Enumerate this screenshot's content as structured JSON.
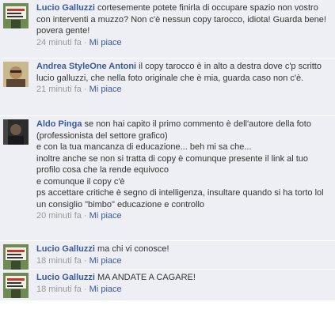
{
  "comments": [
    {
      "author": "Lucio Galluzzi",
      "text": "cortesemente potete finirla di occupare spazio non vostro con interventi a muzzo? Non c'è nessun copy tarocco, idiota! Guarda bene! povera gente!",
      "time": "24 minuti fa",
      "like": "Mi piace",
      "avatar": "avatar-photo-sign-icon"
    },
    {
      "author": "Andrea StyleOne Antoni",
      "text": "il copy tarocco è in alto a destra dove c'p scritto lucio galluzzi, che nella foto originale che è mia, guarda caso non c'è.",
      "time": "21 minuti fa",
      "like": "Mi piace",
      "avatar": "avatar-photo-face-icon"
    },
    {
      "author": "Aldo Pinga",
      "lines": [
        "se non hai capito il primo commento è dell'autore della foto (professionista del settore grafico)",
        "e con la tua mancanza di educazione... beh mi sa che...",
        "inoltre anche se non si tratta di copy è comunque presente il link al tuo profilo cosa che la rende equivoco",
        "e comunque il copy c'è",
        "ps accettare critiche è segno di intelligenza, insultare quando si ha torto lol",
        "un consiglio \"bimbo\" educazione e controllo"
      ],
      "time": "20 minuti fa",
      "like": "Mi piace",
      "avatar": "avatar-photo-dark-icon"
    },
    {
      "author": "Lucio Galluzzi",
      "text": "ma chi vi conosce!",
      "time": "18 minuti fa",
      "like": "Mi piace",
      "avatar": "avatar-photo-sign-icon"
    },
    {
      "author": "Lucio Galluzzi",
      "text": "MA ANDATE A CAGARE!",
      "time": "18 minuti fa",
      "like": "Mi piace",
      "avatar": "avatar-photo-sign-icon"
    }
  ],
  "separator": "·",
  "colors": {
    "comment_bg": "#edeff4",
    "link": "#3b5998",
    "meta": "#999999",
    "text": "#333333"
  }
}
